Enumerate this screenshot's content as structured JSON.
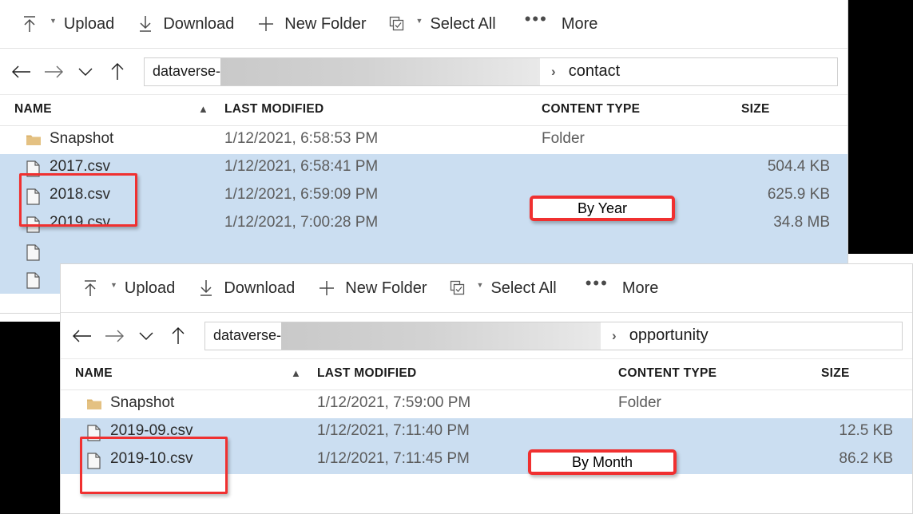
{
  "panels": [
    {
      "id": "contact",
      "toolbar": {
        "upload": "Upload",
        "download": "Download",
        "new_folder": "New Folder",
        "select_all": "Select All",
        "more": "More"
      },
      "breadcrumb": {
        "root": "dataverse-",
        "redacted": "",
        "separator": "›",
        "current": "contact"
      },
      "columns": {
        "name": "NAME",
        "last_modified": "LAST MODIFIED",
        "content_type": "CONTENT TYPE",
        "size": "SIZE"
      },
      "sort": {
        "column": "NAME",
        "direction": "ascending"
      },
      "rows": [
        {
          "name": "Snapshot",
          "modified": "1/12/2021, 6:58:53 PM",
          "type": "Folder",
          "size": "",
          "icon": "folder-icon",
          "selected": false
        },
        {
          "name": "2017.csv",
          "modified": "1/12/2021, 6:58:41 PM",
          "type": "",
          "size": "504.4 KB",
          "icon": "file-icon",
          "selected": true
        },
        {
          "name": "2018.csv",
          "modified": "1/12/2021, 6:59:09 PM",
          "type": "",
          "size": "625.9 KB",
          "icon": "file-icon",
          "selected": true
        },
        {
          "name": "2019.csv",
          "modified": "1/12/2021, 7:00:28 PM",
          "type": "",
          "size": "34.8 MB",
          "icon": "file-icon",
          "selected": true
        },
        {
          "name": "",
          "modified": "",
          "type": "",
          "size": "",
          "icon": "file-icon",
          "selected": true
        },
        {
          "name": "",
          "modified": "",
          "type": "",
          "size": "",
          "icon": "file-icon",
          "selected": true
        }
      ],
      "annotation": {
        "label": "By Year"
      }
    },
    {
      "id": "opportunity",
      "toolbar": {
        "upload": "Upload",
        "download": "Download",
        "new_folder": "New Folder",
        "select_all": "Select All",
        "more": "More"
      },
      "breadcrumb": {
        "root": "dataverse-",
        "redacted": "",
        "separator": "›",
        "current": "opportunity"
      },
      "columns": {
        "name": "NAME",
        "last_modified": "LAST MODIFIED",
        "content_type": "CONTENT TYPE",
        "size": "SIZE"
      },
      "sort": {
        "column": "NAME",
        "direction": "ascending"
      },
      "rows": [
        {
          "name": "Snapshot",
          "modified": "1/12/2021, 7:59:00 PM",
          "type": "Folder",
          "size": "",
          "icon": "folder-icon",
          "selected": false
        },
        {
          "name": "2019-09.csv",
          "modified": "1/12/2021, 7:11:40 PM",
          "type": "",
          "size": "12.5 KB",
          "icon": "file-icon",
          "selected": true
        },
        {
          "name": "2019-10.csv",
          "modified": "1/12/2021, 7:11:45 PM",
          "type": "",
          "size": "86.2 KB",
          "icon": "file-icon",
          "selected": true
        }
      ],
      "annotation": {
        "label": "By Month"
      }
    }
  ],
  "colors": {
    "annotation_red": "#f03030",
    "selection_blue": "#cbdef1",
    "folder_gold": "#dcb46e",
    "text_primary": "#2b2b2b",
    "text_secondary": "#5c5c5c"
  }
}
